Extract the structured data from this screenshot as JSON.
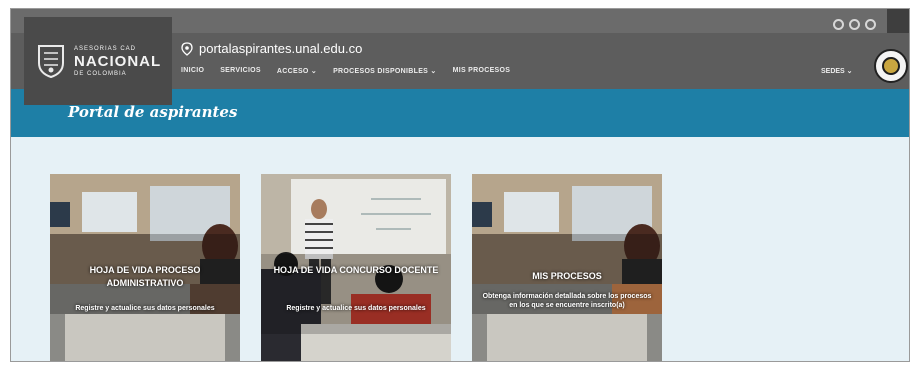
{
  "logo": {
    "line1": "ASESORIAS CAD",
    "line2": "NACIONAL",
    "line3": "DE COLOMBIA"
  },
  "url": "portalaspirantes.unal.edu.co",
  "nav": [
    "INICIO",
    "SERVICIOS",
    "ACCESO ⌄",
    "PROCESOS DISPONIBLES ⌄",
    "MIS PROCESOS"
  ],
  "sedes": "SEDES ⌄",
  "banner_title": "Portal de aspirantes",
  "cards": [
    {
      "title": "HOJA DE VIDA PROCESO ADMINISTRATIVO",
      "description": "Registre y actualice sus datos personales"
    },
    {
      "title": "HOJA DE VIDA CONCURSO DOCENTE",
      "description": "Registre y actualice sus datos personales"
    },
    {
      "title": "MIS PROCESOS",
      "description": "Obtenga información detallada sobre los procesos en los que se encuentre inscrito(a)"
    }
  ],
  "icons": [
    "shield-icon",
    "location-pin-icon",
    "social-icon",
    "colombia-seal-icon"
  ],
  "colors": {
    "header": "#5d5d5d",
    "banner": "#1e7fa6",
    "background": "#e6f1f6"
  }
}
